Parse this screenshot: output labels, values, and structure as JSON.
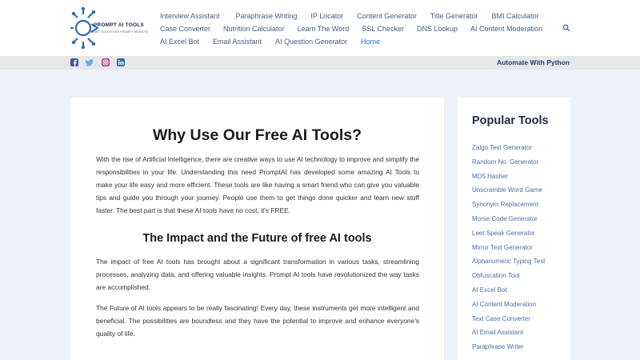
{
  "header": {
    "logo_text": "PROMPT AI TOOLS",
    "logo_tagline": "SMART SOLUTIONS  PROMPT RESULTS",
    "nav_rows": [
      [
        "Interview Assistant",
        "Paraphrase Writing",
        "IP Locator",
        "Content Generator",
        "Title Generator",
        "BMI Calculator"
      ],
      [
        "Case Converter",
        "Nutrition Calculator",
        "Learn The Word",
        "SSL Checker",
        "DNS Lookup",
        "AI Content Moderation"
      ],
      [
        "AI Excel Bot",
        "Email Assistant",
        "AI Question Generator",
        "Home"
      ]
    ],
    "active_nav": "Home",
    "search_icon": "search-icon"
  },
  "social_bar": {
    "icons": [
      "facebook-icon",
      "twitter-icon",
      "instagram-icon",
      "linkedin-icon"
    ],
    "link_label": "Automate With Python"
  },
  "article": {
    "title": "Why Use Our Free AI Tools?",
    "intro": "With the rise of Artificial Intelligence, there are creative ways to use AI technology to improve and simplify the responsibilities in your life. Understanding this need PromptAI has developed some amazing AI Tools to make your life easy and more efficient. These tools are like having a smart friend who can give you valuable tips and guide you through your journey. People use them to get things done quicker and learn new stuff faster. The best part is that these AI tools have no cost, it's FREE.",
    "subtitle": "The Impact and the Future of free AI tools",
    "impact": "The impact of free AI tools has brought about a significant transformation in various tasks, streamlining processes, analyzing data, and offering valuable insights. Prompt AI tools have revolutionized the way tasks are accomplished.",
    "future": "The Future of AI tools appears to be really fascinating! Every day, these instruments get more intelligent and beneficial. The possibilities are boundless and they have the potential to improve and enhance everyone's quality of life."
  },
  "sidebar": {
    "title": "Popular Tools",
    "items": [
      "Zalgo Text Generator",
      "Random No. Generator",
      "MD5 Hasher",
      "Unscramble Word Game",
      "Synonym Replacement",
      "Morse Code Generator",
      "Leet Speak Generator",
      "Mirror Text Generator",
      "Alphanumeric Typing Test",
      "Obfuscation Tool",
      "AI Excel Bot",
      "AI Content Moderation",
      "Text Case Converter",
      "AI Email Assistant",
      "Paraphrase Writer"
    ]
  },
  "colors": {
    "page_bg": "#eef2f8",
    "nav_text": "#4a5e7d",
    "active_nav": "#2d6fc4",
    "sidebar_link": "#4a6fa5",
    "automate_link": "#1f3f74",
    "facebook": "#3b5998",
    "twitter": "#55acee",
    "instagram": "#b13e9a",
    "linkedin": "#2b6fa6"
  }
}
